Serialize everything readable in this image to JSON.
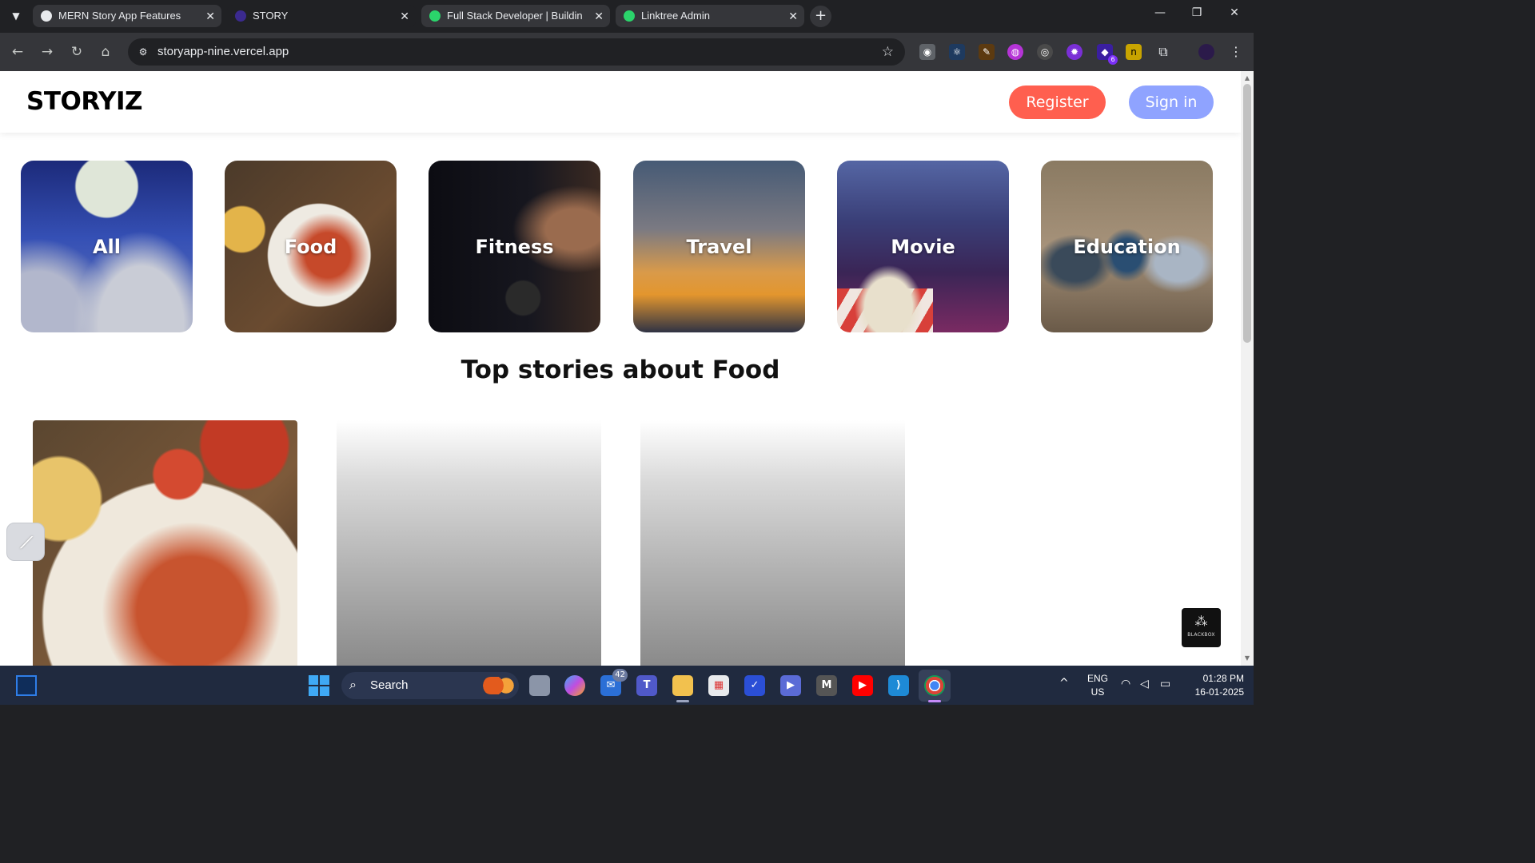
{
  "browser": {
    "tabs": [
      {
        "title": "MERN Story App Features",
        "favicon": "chatgpt-icon",
        "color": "#e8eaed"
      },
      {
        "title": "STORY",
        "favicon": "story-icon",
        "color": "#3b2a8f"
      },
      {
        "title": "Full Stack Developer | Buildin | L",
        "favicon": "linktree-icon",
        "color": "#2bd46b"
      },
      {
        "title": "Linktree Admin",
        "favicon": "linktree-icon",
        "color": "#2bd46b"
      }
    ],
    "new_tab": "+",
    "window_controls": {
      "minimize": "—",
      "restore": "❐",
      "close": "✕"
    },
    "url": "storyapp-nine.vercel.app",
    "extensions": [
      {
        "name": "camera-extension-icon",
        "glyph": "◉",
        "color": "#5f6368"
      },
      {
        "name": "react-devtools-icon",
        "glyph": "⚛",
        "color": "#1e3a5f"
      },
      {
        "name": "color-picker-icon",
        "glyph": "✎",
        "color": "#5c3a10"
      },
      {
        "name": "brain-extension-icon",
        "glyph": "◍",
        "color": "#b534d6"
      },
      {
        "name": "target-extension-icon",
        "glyph": "◎",
        "color": "#4a4a4a"
      },
      {
        "name": "gear-extension-icon",
        "glyph": "✹",
        "color": "#7a2fd6"
      },
      {
        "name": "badge-extension-icon",
        "glyph": "◆",
        "color": "#3a1ea0",
        "badge": "6"
      },
      {
        "name": "n-extension-icon",
        "glyph": "n",
        "color": "#c8a400"
      },
      {
        "name": "puzzle-extensions-icon",
        "glyph": "⧉",
        "color": "#35363a"
      },
      {
        "name": "profile-avatar-icon",
        "glyph": "●",
        "color": "#2b1a4a"
      }
    ]
  },
  "site": {
    "logo": "STORYIZ",
    "register_label": "Register",
    "signin_label": "Sign in",
    "categories": [
      {
        "label": "All"
      },
      {
        "label": "Food"
      },
      {
        "label": "Fitness"
      },
      {
        "label": "Travel"
      },
      {
        "label": "Movie"
      },
      {
        "label": "Education"
      }
    ],
    "section_title": "Top stories about Food",
    "blackbox_label": "BLACKBOX"
  },
  "taskbar": {
    "search_label": "Search",
    "mail_badge": "42",
    "apps": [
      "task-view-icon",
      "copilot-icon",
      "mail-icon",
      "teams-icon",
      "file-explorer-icon",
      "microsoft-store-icon",
      "todo-icon",
      "power-automate-icon",
      "m-app-icon",
      "youtube-icon",
      "vscode-icon",
      "chrome-icon"
    ],
    "lang_line1": "ENG",
    "lang_line2": "US",
    "time": "01:28 PM",
    "date": "16-01-2025"
  }
}
